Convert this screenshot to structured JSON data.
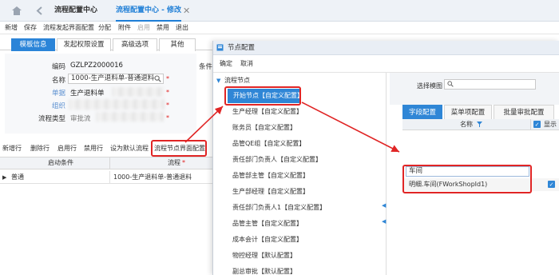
{
  "topbar": {
    "tabs": [
      {
        "label": "流程配置中心"
      },
      {
        "label": "流程配置中心 - 修改"
      }
    ],
    "close_glyph": "✕"
  },
  "toolbar": {
    "items": [
      {
        "label": "新增"
      },
      {
        "label": "保存"
      },
      {
        "label": "流程发起界面配置"
      },
      {
        "label": "分配"
      },
      {
        "label": "附件"
      },
      {
        "label": "启用"
      },
      {
        "label": "禁用"
      },
      {
        "label": "退出"
      }
    ]
  },
  "form_tabs": [
    {
      "label": "模板信息"
    },
    {
      "label": "发起权限设置"
    },
    {
      "label": "高级选项"
    },
    {
      "label": "其他"
    }
  ],
  "form": {
    "code_label": "编码",
    "code_value": "GZLPZ2000016",
    "name_label": "名称",
    "name_value": "1000-生产退料单-普通退料",
    "doc_label": "单据",
    "doc_value": "生产退料单",
    "org_label": "组织",
    "flowtype_label": "流程类型",
    "flowtype_value": "审批流",
    "cond_label": "条件"
  },
  "grid_toolbar": {
    "items": [
      {
        "label": "新增行"
      },
      {
        "label": "删除行"
      },
      {
        "label": "启用行"
      },
      {
        "label": "禁用行"
      },
      {
        "label": "设为默认流程"
      },
      {
        "label": "流程节点界面配置"
      }
    ]
  },
  "grid": {
    "headers": [
      "启动条件",
      "流程"
    ],
    "row": {
      "condition": "普通",
      "flow": "1000-生产退料单-普通退料"
    }
  },
  "dialog": {
    "title": "节点配置",
    "toolbar": [
      {
        "label": "确定"
      },
      {
        "label": "取消"
      }
    ],
    "tree_root": "流程节点",
    "nodes": [
      {
        "label": "开始节点【自定义配置】"
      },
      {
        "label": "生产经理【自定义配置】"
      },
      {
        "label": "账务员【自定义配置】"
      },
      {
        "label": "品管QE组【自定义配置】"
      },
      {
        "label": "责任部门负责人【自定义配置】"
      },
      {
        "label": "品管部主管【自定义配置】"
      },
      {
        "label": "生产部经理【自定义配置】"
      },
      {
        "label": "责任部门负责人1【自定义配置】"
      },
      {
        "label": "品管主管【自定义配置】"
      },
      {
        "label": "成本会计【自定义配置】"
      },
      {
        "label": "物控经理【默认配置】"
      },
      {
        "label": "副总审批【默认配置】"
      }
    ],
    "right": {
      "select_template_label": "选择模图",
      "tabs": [
        {
          "label": "字段配置"
        },
        {
          "label": "菜单项配置"
        },
        {
          "label": "批量审批配置"
        }
      ],
      "col_name": "名称",
      "col_show": "显示",
      "filter_value": "车间",
      "row_value": "明细.车间(FWorkShopId1)"
    }
  },
  "colors": {
    "accent": "#2f86d6",
    "highlight_box": "#e02525"
  },
  "icons": [
    "home-icon",
    "back-icon",
    "search-icon",
    "filter-icon",
    "checkbox-icon",
    "collapse-arrow-icon"
  ]
}
